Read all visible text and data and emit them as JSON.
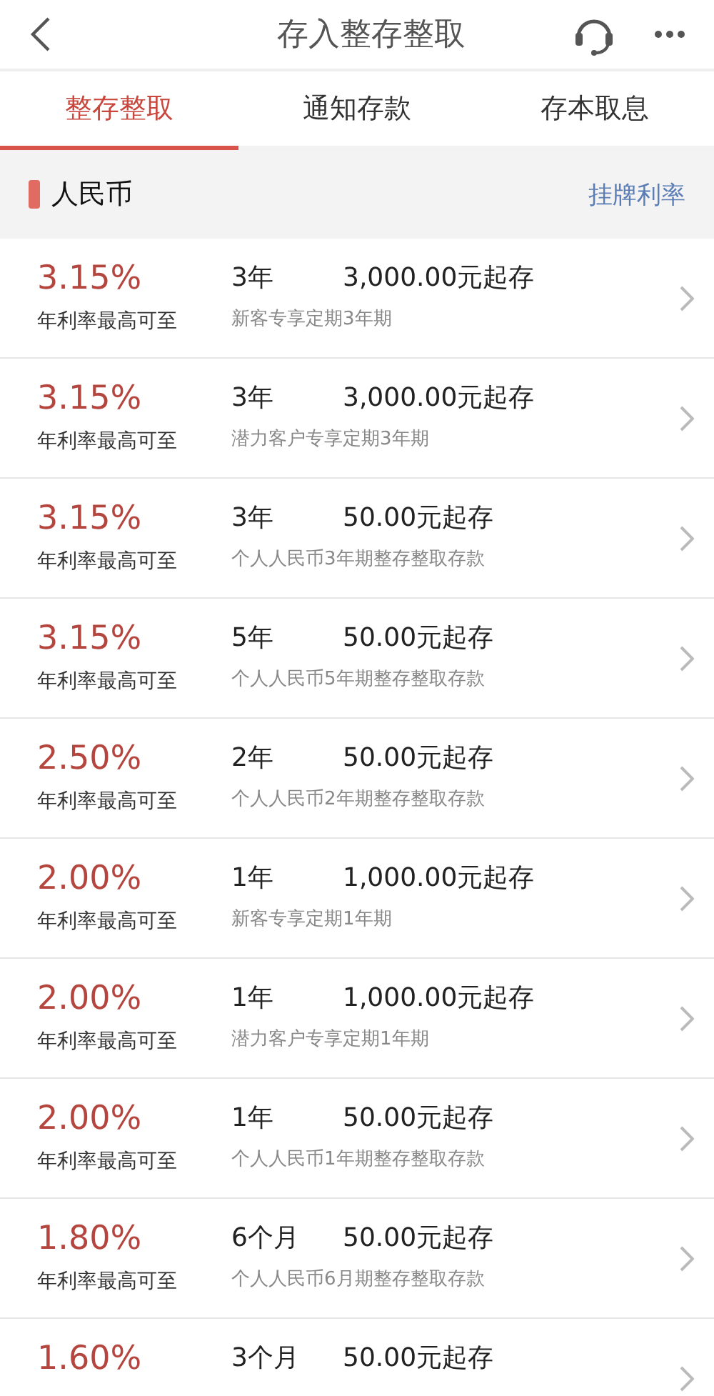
{
  "header": {
    "title": "存入整存整取"
  },
  "tabs": [
    {
      "label": "整存整取",
      "selected": true
    },
    {
      "label": "通知存款",
      "selected": false
    },
    {
      "label": "存本取息",
      "selected": false
    }
  ],
  "section": {
    "title": "人民币",
    "link": "挂牌利率"
  },
  "products": [
    {
      "rate": "3.15%",
      "rate_label": "年利率最高可至",
      "term": "3年",
      "minimum": "3,000.00元起存",
      "name": "新客专享定期3年期"
    },
    {
      "rate": "3.15%",
      "rate_label": "年利率最高可至",
      "term": "3年",
      "minimum": "3,000.00元起存",
      "name": "潜力客户专享定期3年期"
    },
    {
      "rate": "3.15%",
      "rate_label": "年利率最高可至",
      "term": "3年",
      "minimum": "50.00元起存",
      "name": "个人人民币3年期整存整取存款"
    },
    {
      "rate": "3.15%",
      "rate_label": "年利率最高可至",
      "term": "5年",
      "minimum": "50.00元起存",
      "name": "个人人民币5年期整存整取存款"
    },
    {
      "rate": "2.50%",
      "rate_label": "年利率最高可至",
      "term": "2年",
      "minimum": "50.00元起存",
      "name": "个人人民币2年期整存整取存款"
    },
    {
      "rate": "2.00%",
      "rate_label": "年利率最高可至",
      "term": "1年",
      "minimum": "1,000.00元起存",
      "name": "新客专享定期1年期"
    },
    {
      "rate": "2.00%",
      "rate_label": "年利率最高可至",
      "term": "1年",
      "minimum": "1,000.00元起存",
      "name": "潜力客户专享定期1年期"
    },
    {
      "rate": "2.00%",
      "rate_label": "年利率最高可至",
      "term": "1年",
      "minimum": "50.00元起存",
      "name": "个人人民币1年期整存整取存款"
    },
    {
      "rate": "1.80%",
      "rate_label": "年利率最高可至",
      "term": "6个月",
      "minimum": "50.00元起存",
      "name": "个人人民币6月期整存整取存款"
    },
    {
      "rate": "1.60%",
      "term": "3个月",
      "minimum": "50.00元起存"
    }
  ]
}
